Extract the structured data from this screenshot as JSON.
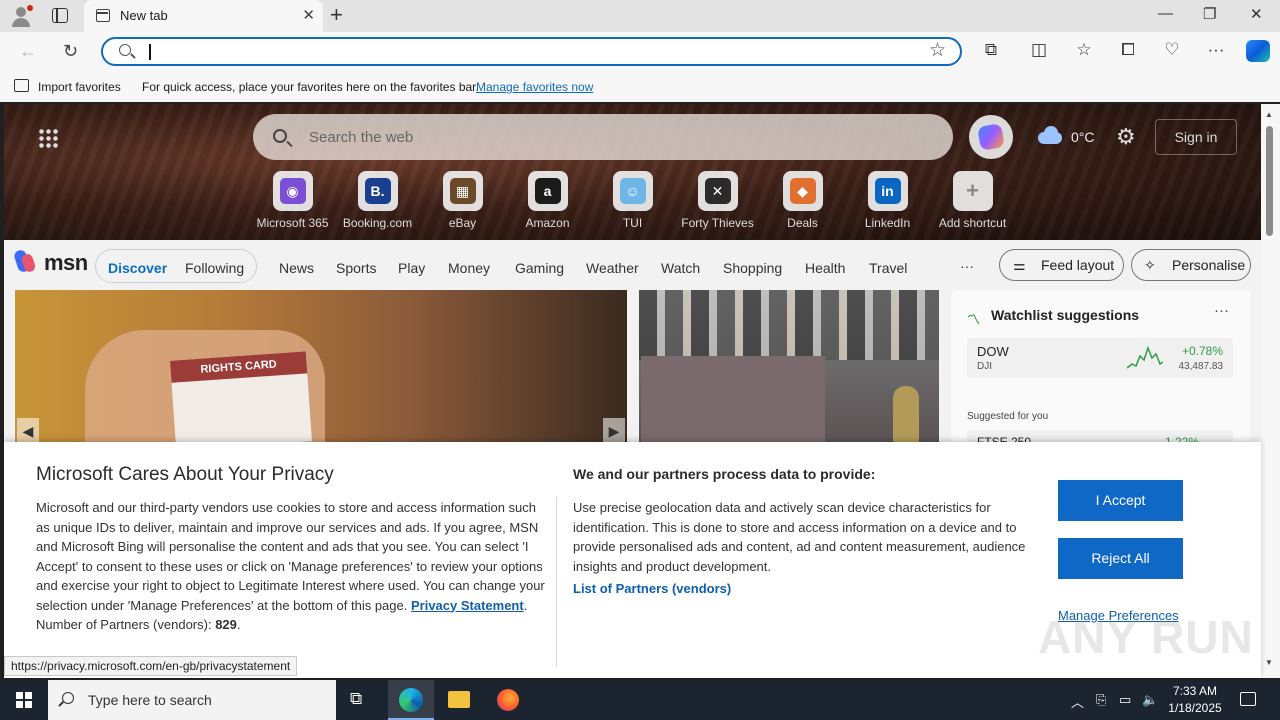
{
  "browser": {
    "tab_title": "New tab",
    "tab_close": "✕",
    "new_tab": "+",
    "window_controls": {
      "minimize": "—",
      "restore": "❐",
      "close": "✕"
    },
    "favorites_bar": {
      "import_label": "Import favorites",
      "hint": "For quick access, place your favorites here on the favorites bar.",
      "manage_link": "Manage favorites now"
    }
  },
  "header": {
    "search_placeholder": "Search the web",
    "temperature": "0°C",
    "sign_in": "Sign in"
  },
  "shortcuts": [
    {
      "label": "Microsoft 365",
      "glyph": "◉",
      "color": "#7a4fd6"
    },
    {
      "label": "Booking.com",
      "glyph": "B.",
      "color": "#1a3f8f"
    },
    {
      "label": "eBay",
      "glyph": "▦",
      "color": "#6b4a2a"
    },
    {
      "label": "Amazon",
      "glyph": "a",
      "color": "#1b1b1b"
    },
    {
      "label": "TUI",
      "glyph": "☺",
      "color": "#6fb6e8"
    },
    {
      "label": "Forty Thieves",
      "glyph": "✕",
      "color": "#2b2b2b"
    },
    {
      "label": "Deals",
      "glyph": "◆",
      "color": "#e07030"
    },
    {
      "label": "LinkedIn",
      "glyph": "in",
      "color": "#0a66c2"
    },
    {
      "label": "Add shortcut",
      "glyph": "+",
      "color": "#888888"
    }
  ],
  "msn": {
    "logo_text": "msn",
    "nav": [
      "Discover",
      "Following",
      "News",
      "Sports",
      "Play",
      "Money",
      "Gaming",
      "Weather",
      "Watch",
      "Shopping",
      "Health",
      "Travel"
    ],
    "more": "···",
    "feed_layout": "Feed layout",
    "personalise": "Personalise"
  },
  "cards": {
    "rights_card": "RIGHTS CARD"
  },
  "watchlist": {
    "title": "Watchlist suggestions",
    "more": "···",
    "item": {
      "symbol": "DOW",
      "sub": "DJI",
      "change": "+0.78%",
      "price": "43,487.83"
    },
    "suggested_label": "Suggested for you",
    "item2": {
      "symbol": "FTSE 250",
      "change": "1.22%"
    }
  },
  "privacy": {
    "title": "Microsoft Cares About Your Privacy",
    "body": "Microsoft and our third-party vendors use cookies to store and access information such as unique IDs to deliver, maintain and improve our services and ads. If you agree, MSN and Microsoft Bing will personalise the content and ads that you see. You can select 'I Accept' to consent to these uses or click on 'Manage preferences' to review your options and exercise your right to object to Legitimate Interest where used.  You can change your selection under 'Manage Preferences' at the bottom of this page.",
    "privacy_link": "Privacy Statement",
    "partners_label": "Number of Partners (vendors):",
    "partners_count": "829",
    "title2": "We and our partners process data to provide:",
    "body2": "Use precise geolocation data and actively scan device characteristics for identification. This is done to store and access information on a device and to provide personalised ads and content, ad and content measurement, audience insights and product development.",
    "partners_link": "List of Partners (vendors)",
    "accept": "I Accept",
    "reject": "Reject All",
    "manage": "Manage Preferences"
  },
  "status_url": "https://privacy.microsoft.com/en-gb/privacystatement",
  "watermark": "ANY RUN",
  "taskbar": {
    "search_placeholder": "Type here to search",
    "time": "7:33 AM",
    "date": "1/18/2025"
  }
}
